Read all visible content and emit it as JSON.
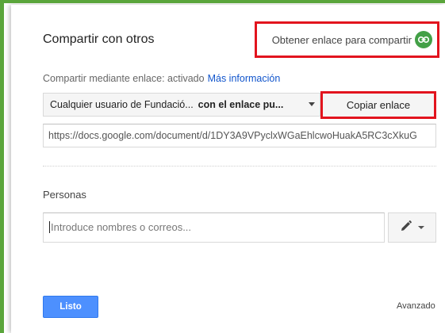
{
  "dialog": {
    "title": "Compartir con otros",
    "get_link_label": "Obtener enlace para compartir",
    "link_sharing_status": "Compartir mediante enlace: activado",
    "more_info_link": "Más información",
    "access_select": {
      "part1": "Cualquier usuario de Fundació...",
      "part2": "con el enlace pu..."
    },
    "copy_link_button": "Copiar enlace",
    "share_url": "https://docs.google.com/document/d/1DY3A9VPyclxWGaEhlcwoHuakA5RC3cXkuG",
    "people_label": "Personas",
    "people_input_placeholder": "Introduce nombres o correos...",
    "done_button": "Listo",
    "advanced_link": "Avanzado"
  },
  "colors": {
    "accent_green": "#5aa53b",
    "highlight_red": "#e2141e",
    "primary_blue": "#4d90fe",
    "link_blue": "#1155cc"
  },
  "icons": [
    "link-icon",
    "chevron-down-icon",
    "pencil-icon"
  ]
}
